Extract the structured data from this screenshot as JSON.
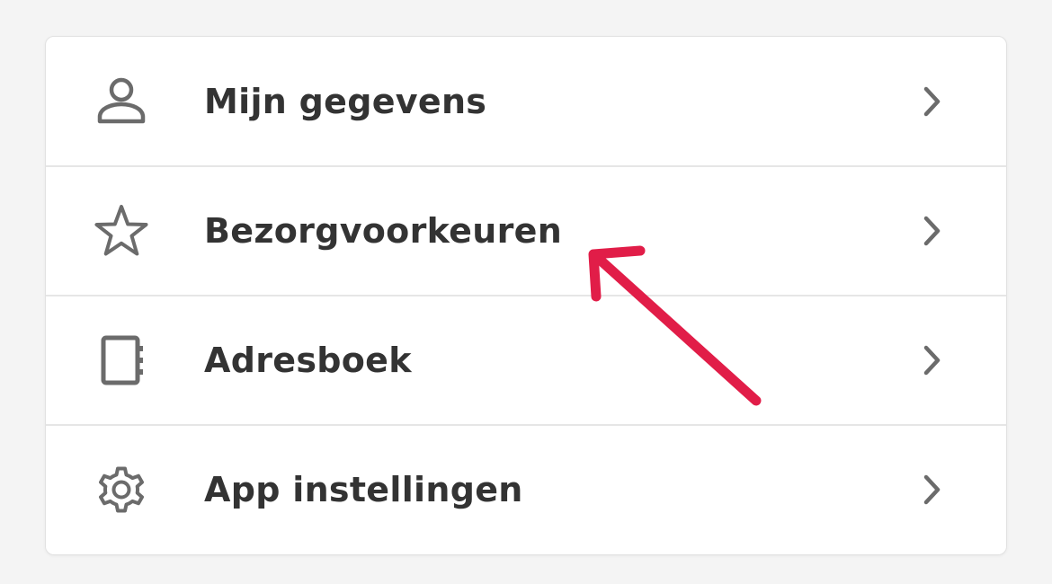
{
  "menu": {
    "items": [
      {
        "label": "Mijn gegevens",
        "icon": "person-icon"
      },
      {
        "label": "Bezorgvoorkeuren",
        "icon": "star-icon"
      },
      {
        "label": "Adresboek",
        "icon": "address-book-icon"
      },
      {
        "label": "App instellingen",
        "icon": "gear-icon"
      }
    ]
  },
  "colors": {
    "text": "#333333",
    "icon": "#6b6b6b",
    "divider": "#e6e6e6",
    "annotation_arrow": "#e11d48"
  }
}
